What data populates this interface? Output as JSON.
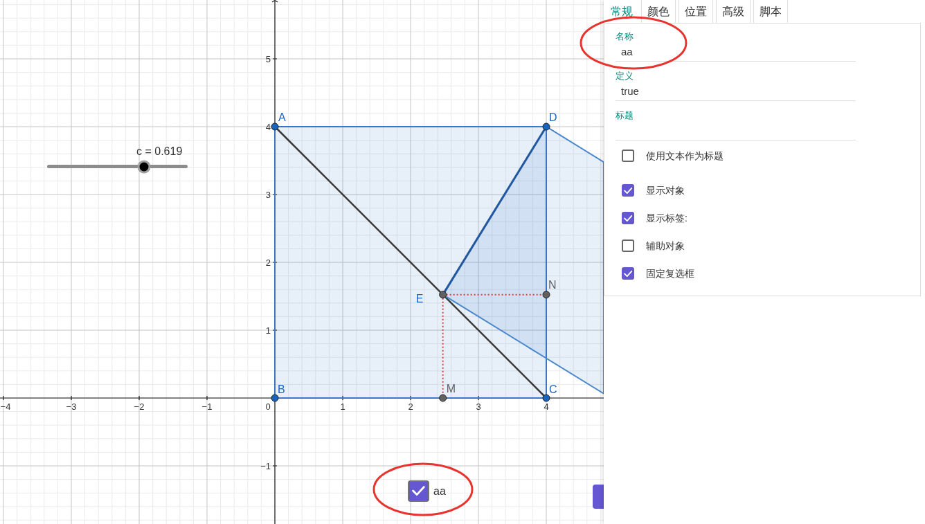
{
  "graphics": {
    "x_axis_labels": [
      "−4",
      "−3",
      "−2",
      "−1",
      "0",
      "1",
      "2",
      "3",
      "4"
    ],
    "y_axis_labels": [
      "5",
      "4",
      "3",
      "2",
      "1",
      "−1"
    ],
    "points": [
      {
        "label": {
          "text": "A",
          "color": "#1565c0"
        },
        "marker": {
          "color": "#1565c0"
        }
      },
      {
        "label": {
          "text": "D",
          "color": "#1565c0"
        },
        "marker": {
          "color": "#1565c0"
        }
      },
      {
        "label": {
          "text": "E",
          "color": "#1565c0"
        },
        "marker": {
          "color": "#616161"
        }
      },
      {
        "label": {
          "text": "N",
          "color": "#616161"
        },
        "marker": {
          "color": "#616161"
        }
      },
      {
        "label": {
          "text": "B",
          "color": "#1565c0"
        },
        "marker": {
          "color": "#1565c0"
        }
      },
      {
        "label": {
          "text": "M",
          "color": "#616161"
        },
        "marker": {
          "color": "#616161"
        }
      },
      {
        "label": {
          "text": "C",
          "color": "#1565c0"
        },
        "marker": {
          "color": "#1565c0"
        }
      }
    ],
    "slider": {
      "label": "c = 0.619",
      "level": 0.69
    },
    "checkbox": {
      "label": "aa",
      "checked": true
    }
  },
  "properties_panel": {
    "tabs": [
      {
        "label": "常规",
        "selected": true
      },
      {
        "label": "颜色",
        "selected": false
      },
      {
        "label": "位置",
        "selected": false
      },
      {
        "label": "高级",
        "selected": false
      },
      {
        "label": "脚本",
        "selected": false
      }
    ],
    "fields": [
      {
        "label": "名称",
        "value": "aa"
      },
      {
        "label": "定义",
        "value": "true"
      },
      {
        "label": "标题"
      }
    ],
    "option_groups": [
      {
        "options": [
          {
            "label": "使用文本作为标题",
            "checked": false
          }
        ]
      },
      {
        "options": [
          {
            "label": "显示对象",
            "checked": true
          },
          {
            "label": "显示标签:",
            "checked": true
          },
          {
            "label": "辅助对象",
            "checked": false
          },
          {
            "label": "固定复选框",
            "checked": true
          }
        ]
      }
    ]
  }
}
